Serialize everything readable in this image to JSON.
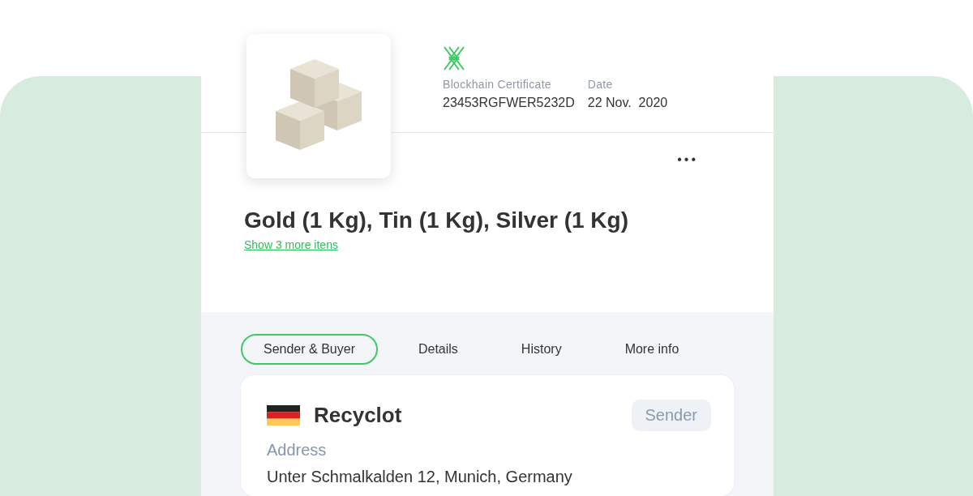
{
  "certificate": {
    "label": "Blockhain Certificate",
    "value": "23453RGFWER5232D"
  },
  "date": {
    "label": "Date",
    "value": "22 Nov.  2020"
  },
  "more_button": "•••",
  "title": "Gold (1 Kg), Tin (1 Kg), Silver (1 Kg)",
  "more_link": "Show 3 more itens",
  "tabs": [
    {
      "label": "Sender & Buyer",
      "selected": true
    },
    {
      "label": "Details",
      "selected": false
    },
    {
      "label": "History",
      "selected": false
    },
    {
      "label": "More info",
      "selected": false
    }
  ],
  "party": {
    "name": "Recyclot",
    "role": "Sender",
    "address_label": "Address",
    "address": "Unter Schmalkalden 12, Munich, Germany"
  }
}
